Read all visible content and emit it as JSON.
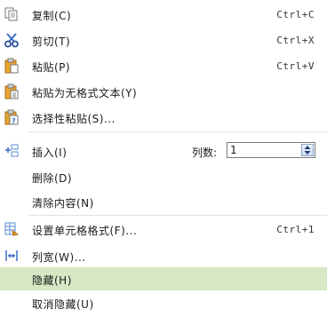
{
  "menu": {
    "copy": {
      "label": "复制(C)",
      "shortcut": "Ctrl+C",
      "icon": "copy-icon"
    },
    "cut": {
      "label": "剪切(T)",
      "shortcut": "Ctrl+X",
      "icon": "scissors-icon"
    },
    "paste": {
      "label": "粘贴(P)",
      "shortcut": "Ctrl+V",
      "icon": "paste-icon"
    },
    "paste_plain": {
      "label": "粘贴为无格式文本(Y)",
      "icon": "paste-text-icon"
    },
    "paste_special": {
      "label": "选择性粘贴(S)...",
      "icon": "paste-special-icon"
    },
    "insert": {
      "label": "插入(I)",
      "icon": "insert-icon",
      "cols_label": "列数:",
      "cols_value": "1"
    },
    "delete": {
      "label": "删除(D)"
    },
    "clear": {
      "label": "清除内容(N)"
    },
    "format_cells": {
      "label": "设置单元格格式(F)...",
      "shortcut": "Ctrl+1",
      "icon": "format-cells-icon"
    },
    "col_width": {
      "label": "列宽(W)...",
      "icon": "column-width-icon"
    },
    "hide": {
      "label": "隐藏(H)"
    },
    "unhide": {
      "label": "取消隐藏(U)"
    }
  },
  "colors": {
    "highlight": "#d6e8c4",
    "separator": "#e2e2e2",
    "icon_blue": "#3a6cc4",
    "icon_orange": "#f0a020"
  }
}
